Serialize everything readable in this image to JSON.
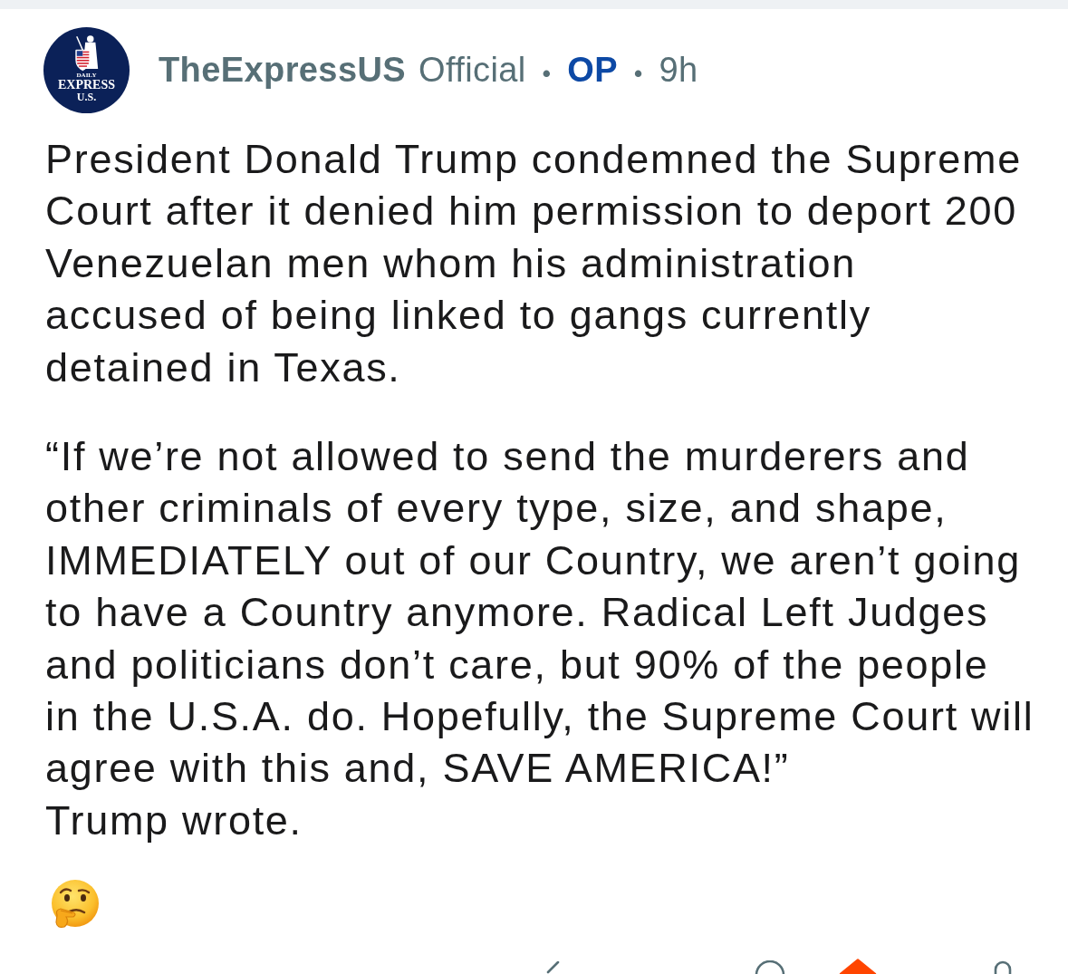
{
  "post": {
    "avatar": {
      "logo_text": [
        "DAILY",
        "EXPRESS",
        "U.S."
      ]
    },
    "meta": [
      {
        "kind": "author",
        "text": "TheExpressUS"
      },
      {
        "kind": "flair",
        "text": "Official"
      },
      {
        "kind": "separator",
        "text": "•"
      },
      {
        "kind": "badge",
        "text": "OP"
      },
      {
        "kind": "separator",
        "text": "•"
      },
      {
        "kind": "time",
        "text": "9h"
      }
    ],
    "paragraphs": [
      {
        "lines": [
          "President Donald Trump condemned the Supreme",
          "Court after it denied him permission to deport 200",
          "Venezuelan men whom his administration",
          "accused of being linked to gangs currently",
          "detained in Texas."
        ]
      },
      {
        "lines": [
          "“If we’re not allowed to send the murderers and",
          "other criminals of every type, size, and shape,",
          "IMMEDIATELY out of our Country, we aren’t going",
          "to have a Country anymore. Radical Left Judges",
          "and politicians don’t care, but 90% of the people",
          "in the U.S.A. do. Hopefully, the Supreme Court will",
          "agree with this and, SAVE AMERICA!”",
          "Trump wrote."
        ]
      }
    ],
    "actions": {
      "upvoted": true
    }
  }
}
